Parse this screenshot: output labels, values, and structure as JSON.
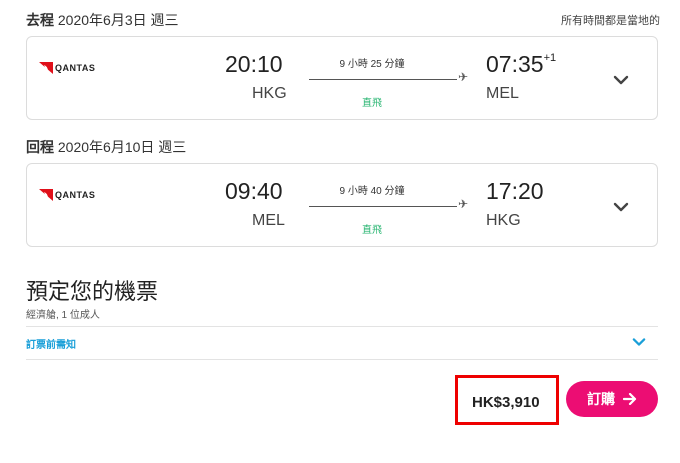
{
  "outbound": {
    "label": "去程",
    "date": "2020年6月3日 週三",
    "airline": "QANTAS",
    "dep_time": "20:10",
    "dep_code": "HKG",
    "duration": "9 小時 25 分鐘",
    "stops": "直飛",
    "arr_time": "07:35",
    "arr_offset": "+1",
    "arr_code": "MEL"
  },
  "timezone_note": "所有時間都是當地的",
  "return": {
    "label": "回程",
    "date": "2020年6月10日 週三",
    "airline": "QANTAS",
    "dep_time": "09:40",
    "dep_code": "MEL",
    "duration": "9 小時 40 分鐘",
    "stops": "直飛",
    "arr_time": "17:20",
    "arr_code": "HKG"
  },
  "booking": {
    "title": "預定您的機票",
    "subtitle": "經濟艙, 1 位成人",
    "notice_label": "訂票前需知",
    "price": "HK$3,910",
    "book_label": "訂購",
    "book_icon": "arrow-right-icon"
  },
  "colors": {
    "accent": "#ec0d73",
    "direct": "#2bb673",
    "link": "#1a9fd8",
    "highlight": "#ee0000"
  }
}
